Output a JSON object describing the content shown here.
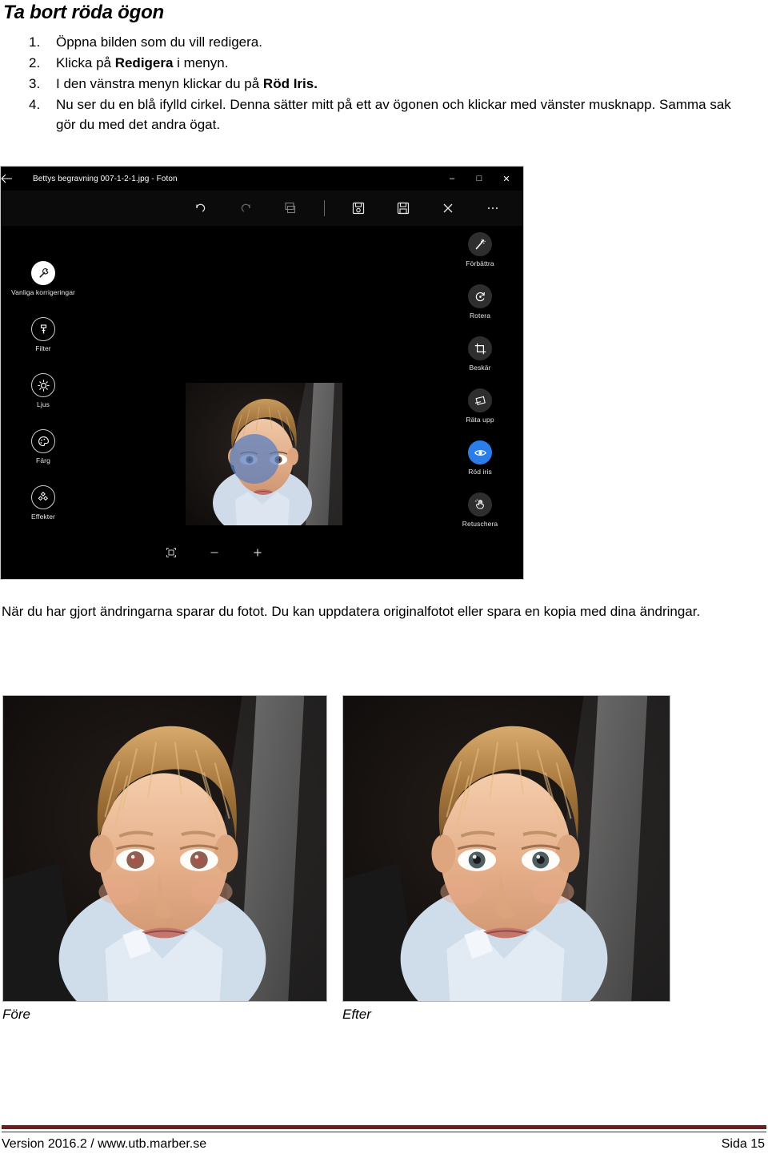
{
  "document": {
    "title": "Ta bort röda ögon",
    "steps": [
      {
        "num": "1.",
        "text": "Öppna bilden som du vill redigera."
      },
      {
        "num": "2.",
        "text_before": "Klicka på ",
        "bold": "Redigera",
        "text_after": " i menyn."
      },
      {
        "num": "3.",
        "text_before": "I den vänstra menyn klickar du på ",
        "bold": "Röd Iris.",
        "text_after": ""
      },
      {
        "num": "4.",
        "text": "Nu ser du en blå ifylld cirkel. Denna sätter mitt på ett av ögonen och klickar med vänster musknapp. Samma sak gör du med det andra ögat."
      }
    ],
    "paragraph": "När du har gjort ändringarna sparar du fotot. Du kan uppdatera originalfotot eller spara en kopia med dina ändringar."
  },
  "app_screenshot": {
    "title": "Bettys begravning 007-1-2-1.jpg - Foton",
    "back_icon": "back-arrow-icon",
    "window_controls": [
      {
        "name": "minimize",
        "glyph": "–"
      },
      {
        "name": "maximize",
        "glyph": "□"
      },
      {
        "name": "close",
        "glyph": "✕"
      }
    ],
    "toolbar": [
      {
        "name": "undo",
        "icon": "undo-icon",
        "enabled": true
      },
      {
        "name": "redo",
        "icon": "redo-icon",
        "enabled": false
      },
      {
        "name": "compare",
        "icon": "compare-icon",
        "enabled": false
      },
      {
        "name": "separator",
        "icon": "divider",
        "enabled": false
      },
      {
        "name": "save-copy",
        "icon": "save-copy-icon",
        "enabled": true
      },
      {
        "name": "save",
        "icon": "save-icon",
        "enabled": true
      },
      {
        "name": "cancel",
        "icon": "close-x-icon",
        "enabled": true
      },
      {
        "name": "more",
        "icon": "ellipsis-icon",
        "enabled": true
      }
    ],
    "left_rail": [
      {
        "label": "Vanliga korrigeringar",
        "icon": "wrench-icon",
        "state": "selected"
      },
      {
        "label": "Filter",
        "icon": "brush-icon",
        "state": "normal"
      },
      {
        "label": "Ljus",
        "icon": "brightness-icon",
        "state": "normal"
      },
      {
        "label": "Färg",
        "icon": "palette-icon",
        "state": "normal"
      },
      {
        "label": "Effekter",
        "icon": "effects-icon",
        "state": "normal"
      }
    ],
    "right_rail": [
      {
        "label": "Förbättra",
        "icon": "magic-wand-icon",
        "state": "normal"
      },
      {
        "label": "Rotera",
        "icon": "rotate-icon",
        "state": "normal"
      },
      {
        "label": "Beskär",
        "icon": "crop-icon",
        "state": "normal"
      },
      {
        "label": "Räta upp",
        "icon": "straighten-icon",
        "state": "normal"
      },
      {
        "label": "Röd iris",
        "icon": "eye-icon",
        "state": "active"
      },
      {
        "label": "Retuschera",
        "icon": "retouch-hand-icon",
        "state": "normal"
      }
    ],
    "zoom_controls": [
      {
        "name": "fit-to-window",
        "icon": "fit-icon"
      },
      {
        "name": "zoom-out",
        "icon": "minus-icon"
      },
      {
        "name": "zoom-in",
        "icon": "plus-icon"
      }
    ],
    "canvas": {
      "overlay_name": "red-eye-brush-circle",
      "overlay_color": "#5b7fc0"
    }
  },
  "figures": [
    {
      "caption": "Före",
      "alt": "portrait-with-red-eyes"
    },
    {
      "caption": "Efter",
      "alt": "portrait-corrected-eyes"
    }
  ],
  "footer": {
    "left": "Version 2016.2 / www.utb.marber.se",
    "right": "Sida 15",
    "rule_color": "#6d1f1f"
  }
}
